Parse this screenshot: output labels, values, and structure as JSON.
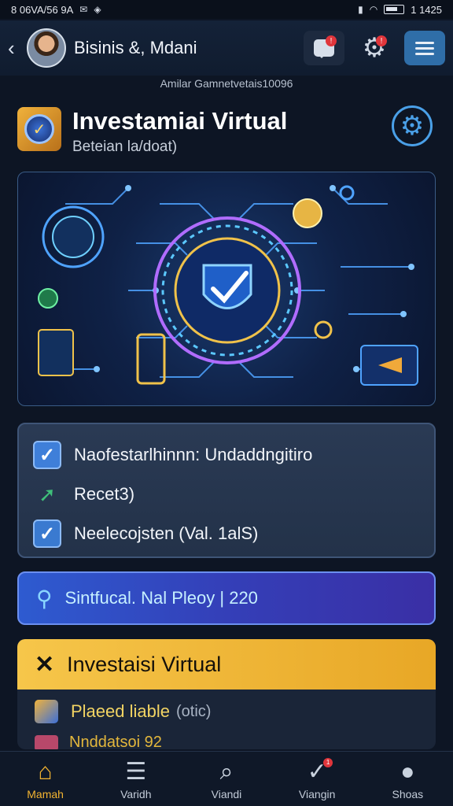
{
  "status_bar": {
    "left": "8 06VA/56 9A",
    "time": "1 1425"
  },
  "header": {
    "back": "‹",
    "title": "Bisinis &, Mdani",
    "chat_badge": "!",
    "settings_badge": "!"
  },
  "subheading": "Amilar Gamnetvetais10096",
  "section": {
    "title": "Investamiai Virtual",
    "subtitle": "Beteian la/doat)"
  },
  "status_card": {
    "rows": [
      {
        "text": "Naofestarlhinnn: Undaddngitiro"
      },
      {
        "text": "Recet3)"
      },
      {
        "text": "Neelecojsten (Val. 1alS)"
      }
    ]
  },
  "search": {
    "text": "Sintfucal. Nal Pleoy | 220"
  },
  "invest": {
    "title": "Investaisi Virtual",
    "row_label": "Plaeed liable",
    "row_sub": "(otic)",
    "cut_text": "Nnddatsoi 92"
  },
  "nav": {
    "items": [
      {
        "label": "Mamah",
        "glyph": "⌂"
      },
      {
        "label": "Varidh",
        "glyph": "☰"
      },
      {
        "label": "Viandi",
        "glyph": "⌕"
      },
      {
        "label": "Viangin",
        "glyph": "✓",
        "badge": "1"
      },
      {
        "label": "Shoas",
        "glyph": "●"
      }
    ]
  },
  "colors": {
    "accent": "#f3b431",
    "primary": "#2e5bd0",
    "background": "#0d1524"
  },
  "icons": {
    "back": "chevron-left-icon",
    "chat": "chat-icon",
    "gear": "gear-icon",
    "menu": "hamburger-icon",
    "search": "search-icon",
    "close": "close-icon"
  }
}
